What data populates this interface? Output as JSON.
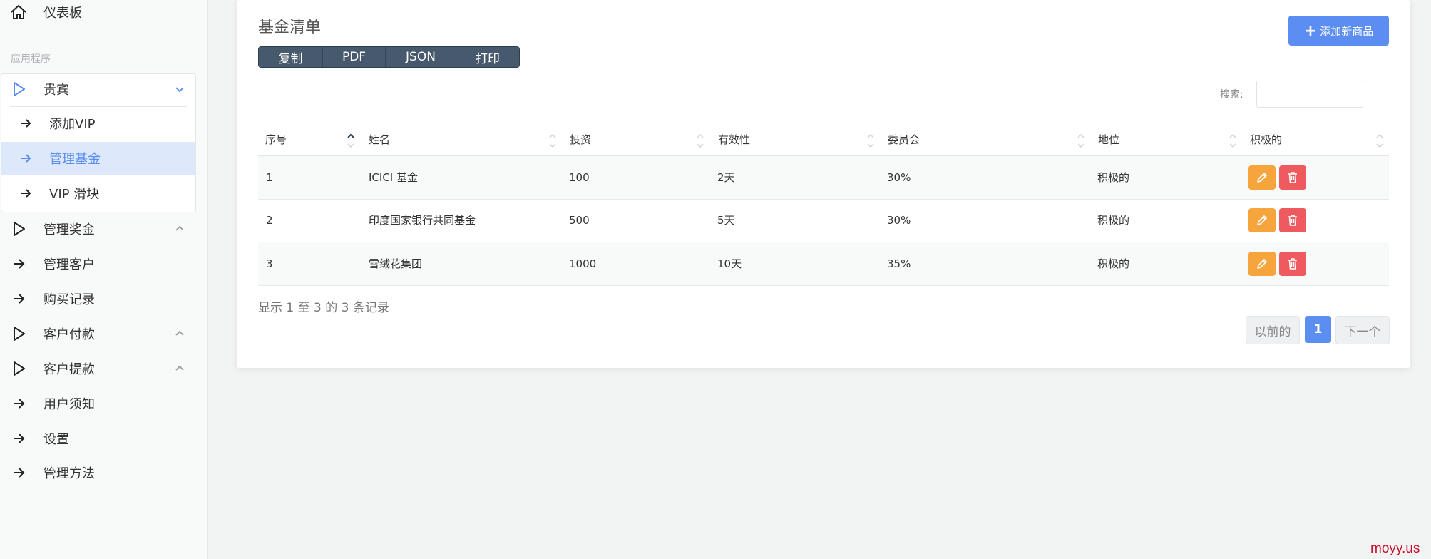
{
  "sidebar": {
    "dashboard": "仪表板",
    "section_title": "应用程序",
    "vip": {
      "label": "贵宾",
      "items": [
        "添加VIP",
        "管理基金",
        "VIP 滑块"
      ]
    },
    "items": [
      "管理奖金",
      "管理客户",
      "购买记录",
      "客户付款",
      "客户提款",
      "用户须知",
      "设置",
      "管理方法"
    ]
  },
  "main": {
    "title": "基金清单",
    "export_buttons": [
      "复制",
      "PDF",
      "JSON",
      "打印"
    ],
    "add_button": "添加新商品",
    "search_label": "搜索:",
    "search_value": "",
    "columns": [
      "序号",
      "姓名",
      "投资",
      "有效性",
      "委员会",
      "地位",
      "积极的"
    ],
    "rows": [
      [
        "1",
        "ICICI 基金",
        "100",
        "2天",
        "30%",
        "积极的"
      ],
      [
        "2",
        "印度国家银行共同基金",
        "500",
        "5天",
        "30%",
        "积极的"
      ],
      [
        "3",
        "雪绒花集团",
        "1000",
        "10天",
        "35%",
        "积极的"
      ]
    ],
    "info": "显示 1 至 3 的 3 条记录",
    "pagination": {
      "prev": "以前的",
      "current": "1",
      "next": "下一个"
    }
  },
  "watermark": "moyy.us",
  "colors": {
    "accent": "#5b8ef0",
    "edit": "#f5a53b",
    "delete": "#ef5a5e",
    "export_bg": "#47596c"
  },
  "icons": {
    "dashboard": "home-icon",
    "groups": "triangle-play-icon",
    "links": "arrow-right-icon",
    "row_actions": [
      "pencil-icon",
      "trash-icon"
    ]
  }
}
